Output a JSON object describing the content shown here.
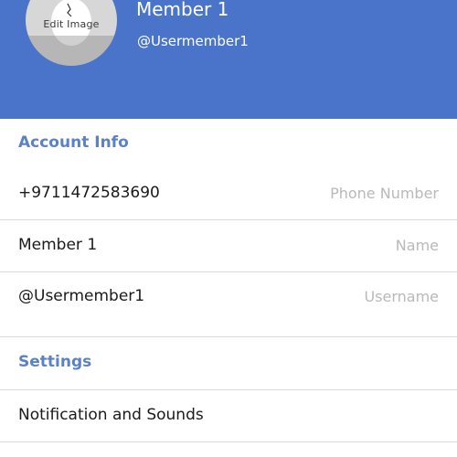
{
  "profile": {
    "name": "Member 1",
    "username": "@Usermember1",
    "edit_image_label": "Edit Image"
  },
  "account_info": {
    "section_title": "Account Info",
    "rows": [
      {
        "value": "+9711472583690",
        "label": "Phone Number"
      },
      {
        "value": "Member 1",
        "label": "Name"
      },
      {
        "value": "@Usermember1",
        "label": "Username"
      }
    ]
  },
  "settings": {
    "section_title": "Settings",
    "items": [
      {
        "label": "Notification and Sounds"
      }
    ]
  },
  "colors": {
    "header_bg": "#4a74c9",
    "section_title": "#5b82c7",
    "placeholder": "#b9b9b9"
  }
}
